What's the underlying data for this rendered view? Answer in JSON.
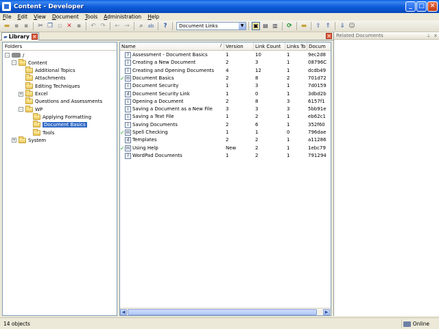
{
  "window": {
    "title": "Content - Developer",
    "min": "_",
    "max": "□",
    "close": "✕"
  },
  "menu": [
    "File",
    "Edit",
    "View",
    "Document",
    "Tools",
    "Administration",
    "Help"
  ],
  "toolbar": {
    "view_select": "Document Links"
  },
  "tabs": {
    "library": "Library"
  },
  "folders": {
    "header": "Folders",
    "root": "/",
    "items": [
      {
        "label": "Content",
        "level": 1,
        "expander": "-"
      },
      {
        "label": "Additional Topics",
        "level": 2
      },
      {
        "label": "Attachments",
        "level": 2
      },
      {
        "label": "Editing Techniques",
        "level": 2
      },
      {
        "label": "Excel",
        "level": 2,
        "expander": "+"
      },
      {
        "label": "Questions and Assessments",
        "level": 2
      },
      {
        "label": "WP",
        "level": 2,
        "expander": "-"
      },
      {
        "label": "Applying Formatting",
        "level": 3
      },
      {
        "label": "Document Basics",
        "level": 3,
        "selected": true
      },
      {
        "label": "Tools",
        "level": 3
      },
      {
        "label": "System",
        "level": 1,
        "expander": "+"
      }
    ]
  },
  "documents": {
    "columns": [
      "Name",
      "Version",
      "Link Count",
      "Links To",
      "Docum"
    ],
    "rows": [
      {
        "check": false,
        "icon": "?",
        "name": "Assessment - Document Basics",
        "version": "1",
        "link_count": "10",
        "links_to": "1",
        "id": "9ec2d8"
      },
      {
        "check": false,
        "icon": "i",
        "name": "Creating a New Document",
        "version": "2",
        "link_count": "3",
        "links_to": "1",
        "id": "08796C"
      },
      {
        "check": false,
        "icon": "i",
        "name": "Creating and Opening Documents",
        "version": "4",
        "link_count": "12",
        "links_to": "1",
        "id": "dcdb49"
      },
      {
        "check": true,
        "icon": "m",
        "name": "Document Basics",
        "version": "2",
        "link_count": "8",
        "links_to": "2",
        "id": "701d72"
      },
      {
        "check": false,
        "icon": "i",
        "name": "Document Security",
        "version": "1",
        "link_count": "3",
        "links_to": "1",
        "id": "7d0159"
      },
      {
        "check": false,
        "icon": "d",
        "name": "Document Security Link",
        "version": "1",
        "link_count": "0",
        "links_to": "1",
        "id": "3dbd2b"
      },
      {
        "check": false,
        "icon": "i",
        "name": "Opening a Document",
        "version": "2",
        "link_count": "8",
        "links_to": "3",
        "id": "6157f1"
      },
      {
        "check": false,
        "icon": "i",
        "name": "Saving a Document as a New File",
        "version": "3",
        "link_count": "3",
        "links_to": "3",
        "id": "5bb91e"
      },
      {
        "check": false,
        "icon": "i",
        "name": "Saving a Text File",
        "version": "1",
        "link_count": "2",
        "links_to": "1",
        "id": "eb62c1"
      },
      {
        "check": false,
        "icon": "i",
        "name": "Saving Documents",
        "version": "2",
        "link_count": "6",
        "links_to": "1",
        "id": "352f60"
      },
      {
        "check": true,
        "icon": "m",
        "name": "Spell Checking",
        "version": "1",
        "link_count": "1",
        "links_to": "0",
        "id": "796dae"
      },
      {
        "check": false,
        "icon": "d",
        "name": "Templates",
        "version": "2",
        "link_count": "2",
        "links_to": "1",
        "id": "a11286"
      },
      {
        "check": true,
        "icon": "m",
        "name": "Using Help",
        "version": "New",
        "link_count": "2",
        "links_to": "1",
        "id": "1ebc79"
      },
      {
        "check": false,
        "icon": "?",
        "name": "WordPad Documents",
        "version": "1",
        "link_count": "2",
        "links_to": "1",
        "id": "791294"
      }
    ]
  },
  "related": {
    "header": "Related Documents",
    "pin": "📌",
    "close": "x"
  },
  "status": {
    "left": "14 objects",
    "right": "Online"
  }
}
